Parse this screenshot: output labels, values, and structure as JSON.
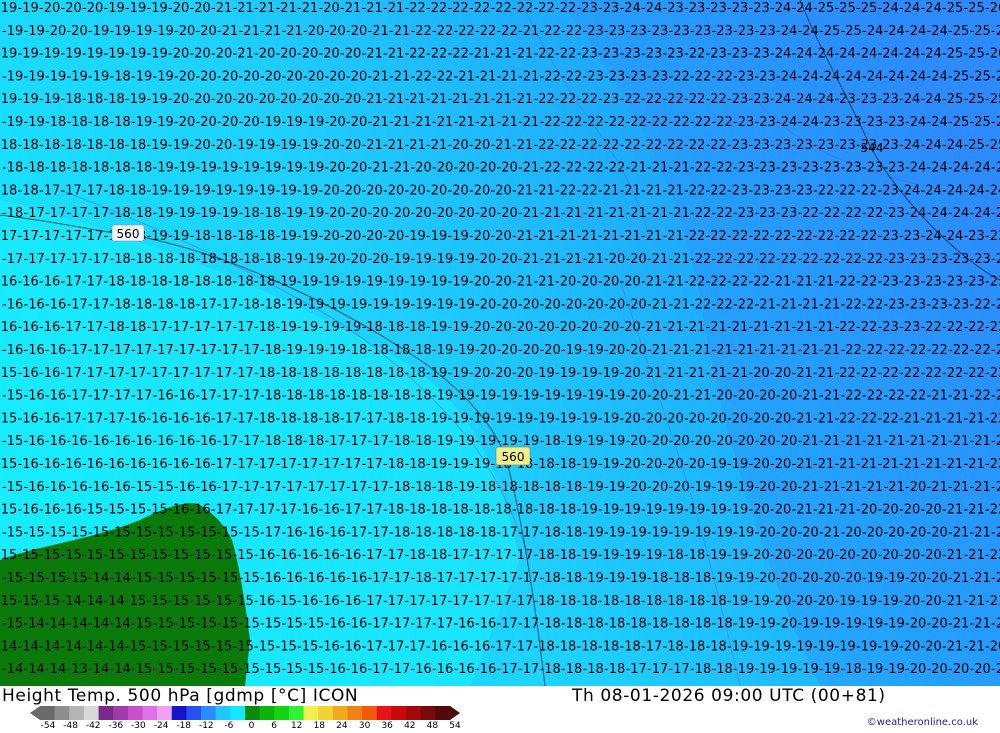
{
  "map": {
    "contour_labels": [
      {
        "value": "560",
        "box_color": "#f4f4f4"
      },
      {
        "value": "560",
        "box_color": "#f0f08a"
      },
      {
        "value": "544",
        "box_color": "none"
      }
    ],
    "land_color": "#0a7a0a",
    "field_colors": [
      "#14e8ff",
      "#1ed0ff",
      "#1eaaff",
      "#2b8cff"
    ]
  },
  "footer": {
    "title_left": "Height Temp. 500 hPa [gdmp [°C] ICON",
    "title_right": "Th 08-01-2026 09:00 UTC (00+81)",
    "credit": "©weatheronline.co.uk",
    "legend_ticks": [
      "-54",
      "-48",
      "-42",
      "-36",
      "-30",
      "-24",
      "-18",
      "-12",
      "-6",
      "0",
      "6",
      "12",
      "18",
      "24",
      "30",
      "36",
      "42",
      "48",
      "54"
    ],
    "legend_colors": [
      "#6a6a6a",
      "#8e8e8e",
      "#b4b4b4",
      "#d8d8d8",
      "#7a2a8a",
      "#a03aa8",
      "#c850c8",
      "#e070e8",
      "#f0a0f0",
      "#1414c8",
      "#2850f0",
      "#2c8cff",
      "#1ec8ff",
      "#14e8ff",
      "#0a8a0a",
      "#0ab40a",
      "#14d214",
      "#32f032",
      "#f0f050",
      "#f0d232",
      "#f0aa1e",
      "#f08214",
      "#f05a0a",
      "#e61414",
      "#c80a0a",
      "#a00a0a",
      "#780a0a",
      "#500a0a"
    ]
  }
}
